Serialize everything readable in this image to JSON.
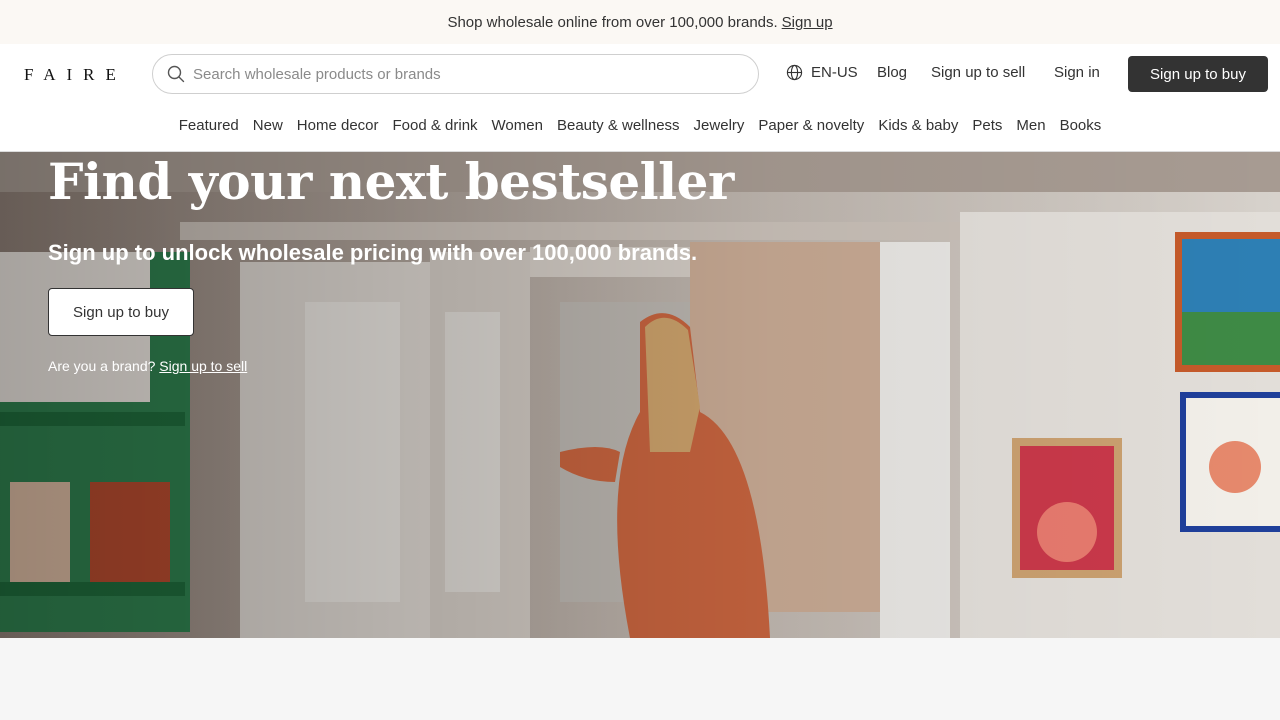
{
  "announcement": {
    "text": "Shop wholesale online from over 100,000 brands.",
    "link": "Sign up"
  },
  "header": {
    "logo": "FAIRE",
    "search_placeholder": "Search wholesale products or brands",
    "language": "EN-US",
    "blog": "Blog",
    "sell": "Sign up to sell",
    "sign_in": "Sign in",
    "buy": "Sign up to buy",
    "primary_color": "#333333"
  },
  "categories": [
    "Featured",
    "New",
    "Home decor",
    "Food & drink",
    "Women",
    "Beauty & wellness",
    "Jewelry",
    "Paper & novelty",
    "Kids & baby",
    "Pets",
    "Men",
    "Books"
  ],
  "hero": {
    "title": "Find your next bestseller",
    "subtitle": "Sign up to unlock wholesale pricing with over 100,000 brands.",
    "cta": "Sign up to buy",
    "brand_prompt": "Are you a brand?",
    "brand_link": "Sign up to sell"
  },
  "icons": {
    "search": "search-icon",
    "language": "globe-icon"
  }
}
